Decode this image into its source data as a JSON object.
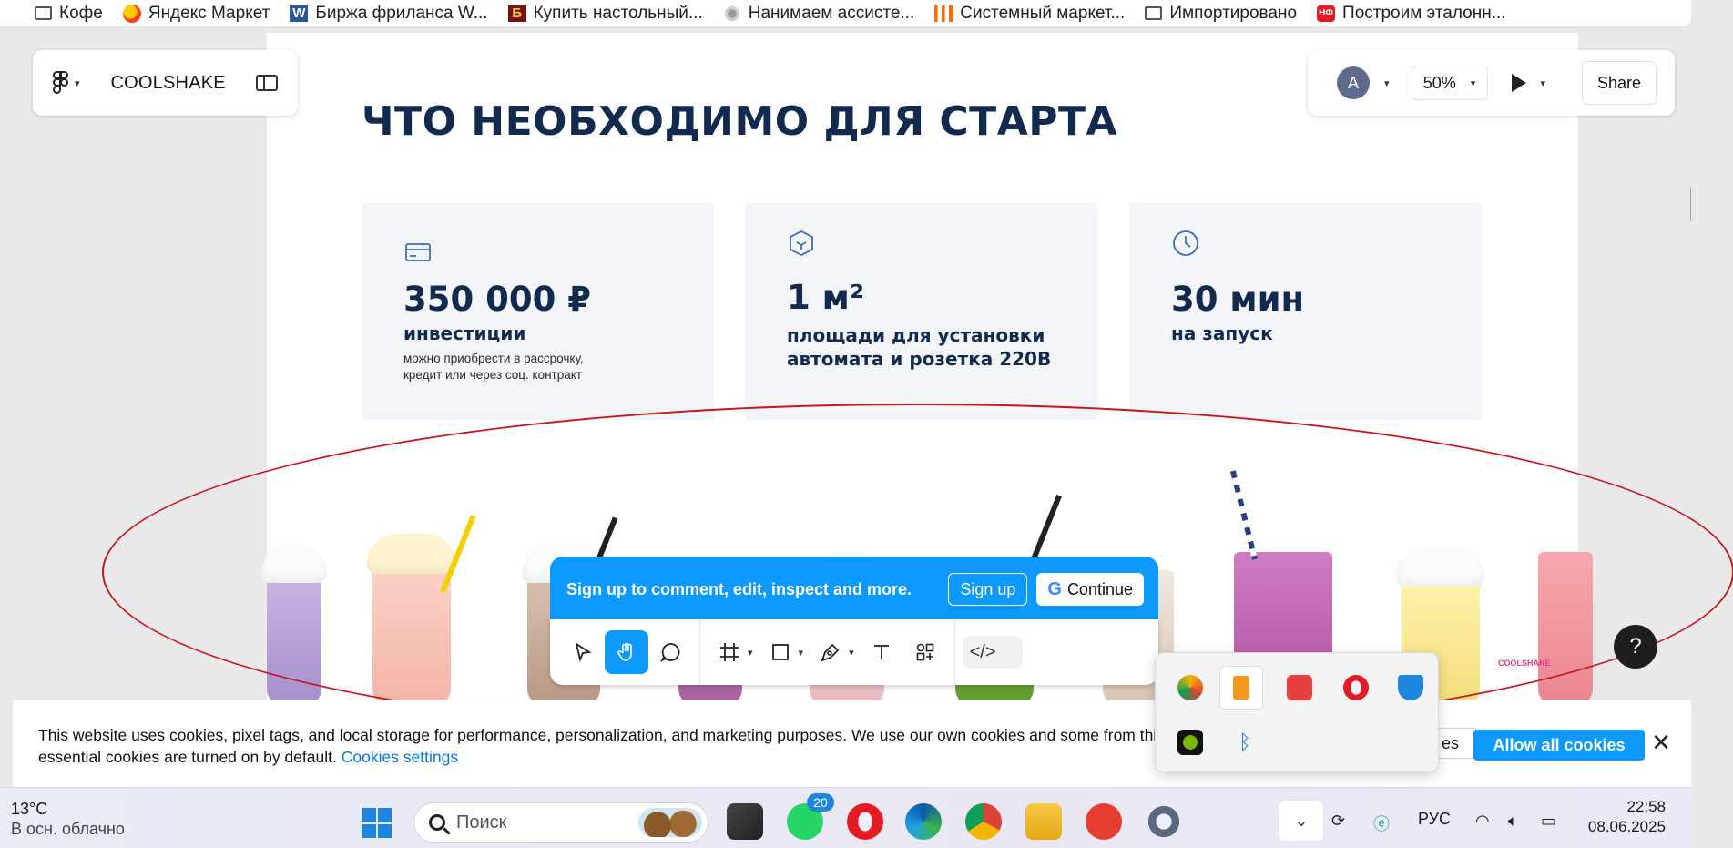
{
  "bookmarks": [
    {
      "label": "Кофе",
      "icon": "folder-icon"
    },
    {
      "label": "Яндекс Маркет",
      "icon": "yandex-market-icon"
    },
    {
      "label": "Биржа фриланса W...",
      "icon": "w-icon"
    },
    {
      "label": "Купить настольный...",
      "icon": "b-icon"
    },
    {
      "label": "Нанимаем ассисте...",
      "icon": "gear-icon"
    },
    {
      "label": "Системный маркет...",
      "icon": "bars-icon"
    },
    {
      "label": "Импортировано",
      "icon": "folder-icon"
    },
    {
      "label": "Построим эталонн...",
      "icon": "red-logo-icon"
    }
  ],
  "figma": {
    "file_name": "COOLSHAKE",
    "avatar_letter": "A",
    "zoom": "50%",
    "share_label": "Share"
  },
  "slide": {
    "title": "ЧТО НЕОБХОДИМО ДЛЯ СТАРТА",
    "cards": [
      {
        "icon": "card-icon",
        "value": "350 000 ₽",
        "label": "инвестиции",
        "note_line1": "можно приобрести  в рассрочку,",
        "note_line2": "кредит или через соц. контракт"
      },
      {
        "icon": "cube-icon",
        "value": "1 м²",
        "label_line1": "площади для установки",
        "label_line2": "автомата и розетка 220В"
      },
      {
        "icon": "clock-icon",
        "value": "30 мин",
        "label": "на запуск"
      }
    ],
    "brand_mark": "COOLSHAKE"
  },
  "signup_banner": {
    "text": "Sign up to comment, edit, inspect and more.",
    "signup_label": "Sign up",
    "continue_label": "Continue"
  },
  "cookie": {
    "text_line1": "This website uses cookies, pixel tags, and local storage for performance, personalization, and marketing purposes. We use our own cookies and some from third parties. Only",
    "text_line2": "essential cookies are turned on by default.",
    "settings_link": "Cookies settings",
    "partial_button": "es",
    "allow_label": "Allow all cookies"
  },
  "taskbar": {
    "temperature": "13°C",
    "weather": "В осн. облачно",
    "search_placeholder": "Поиск",
    "whatsapp_badge": "20",
    "language": "РУС",
    "time": "22:58",
    "date": "08.06.2025"
  },
  "help_label": "?"
}
